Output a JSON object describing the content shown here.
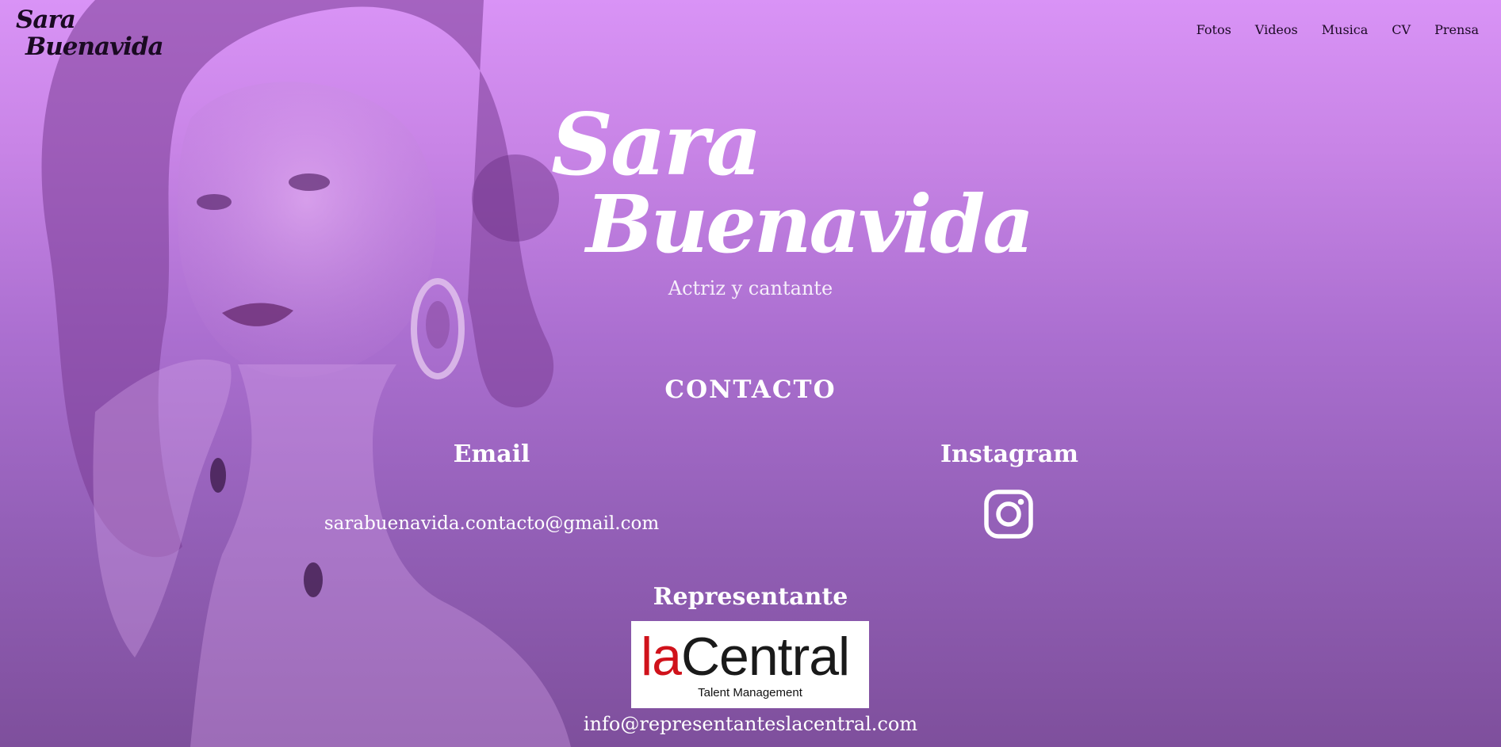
{
  "header": {
    "logo_line1": "Sara",
    "logo_line2": "Buenavida",
    "nav": [
      {
        "label": "Fotos"
      },
      {
        "label": "Videos"
      },
      {
        "label": "Musica"
      },
      {
        "label": "CV"
      },
      {
        "label": "Prensa"
      }
    ]
  },
  "hero": {
    "title_line1": "Sara",
    "title_line2": "Buenavida",
    "subtitle": "Actriz y cantante"
  },
  "contact": {
    "section_title": "CONTACTO",
    "email": {
      "heading": "Email",
      "address": "sarabuenavida.contacto@gmail.com"
    },
    "instagram": {
      "heading": "Instagram",
      "icon": "instagram-icon"
    },
    "representative": {
      "heading": "Representante",
      "logo_text_red": "la",
      "logo_text_black": "Central",
      "logo_tagline": "Talent Management",
      "email": "info@representanteslacentral.com"
    }
  },
  "colors": {
    "overlay_top": "#d993f6",
    "overlay_bottom": "#7e4f9c",
    "nav_text": "#1c0a25",
    "brand_red": "#d0121b"
  }
}
